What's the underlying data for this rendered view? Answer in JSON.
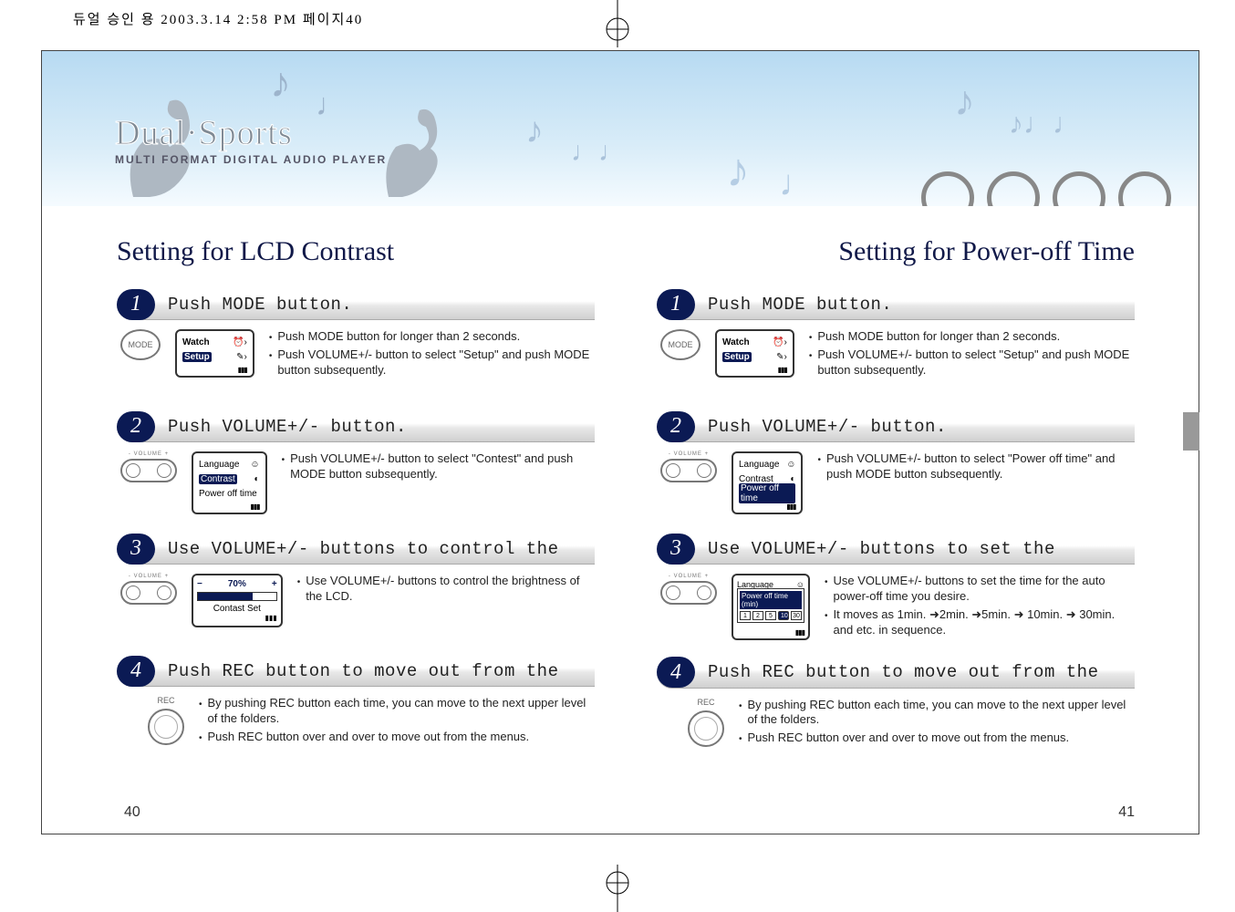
{
  "header_info": "듀얼 승인 용  2003.3.14 2:58 PM  페이지40",
  "brand": "Dual·Sports",
  "brand_sub": "MULTI FORMAT DIGITAL AUDIO PLAYER",
  "left": {
    "title": "Setting for LCD Contrast",
    "steps": [
      {
        "num": "1",
        "title": "Push MODE button.",
        "device": "mode",
        "lcd": {
          "rows": [
            "Watch",
            "Setup"
          ],
          "selected": 1,
          "icons": [
            "⏰›",
            "✎›"
          ]
        },
        "bullets": [
          "Push MODE button for longer than 2 seconds.",
          "Push VOLUME+/- button to select \"Setup\" and push MODE button subsequently."
        ]
      },
      {
        "num": "2",
        "title": "Push VOLUME+/- button.",
        "device": "volume",
        "lcd": {
          "rows": [
            "Language",
            "Contrast",
            "Power off time"
          ],
          "selected": 1,
          "icons": [
            "☺",
            "◐",
            ""
          ]
        },
        "bullets": [
          "Push VOLUME+/- button to select \"Contest\" and push MODE button subsequently."
        ]
      },
      {
        "num": "3",
        "title": "Use VOLUME+/- buttons to control the",
        "device": "volume",
        "lcd_bar": {
          "pct": "70%",
          "label": "Contast Set"
        },
        "bullets": [
          "Use VOLUME+/- buttons to control the brightness of the LCD."
        ]
      },
      {
        "num": "4",
        "title": "Push REC button to move out from the",
        "device": "rec",
        "bullets": [
          "By pushing REC button each time, you can move to the next upper level of the folders.",
          "Push REC button over and over to move out from the menus."
        ]
      }
    ],
    "page": "40"
  },
  "right": {
    "title": "Setting for Power-off Time",
    "steps": [
      {
        "num": "1",
        "title": "Push MODE button.",
        "device": "mode",
        "lcd": {
          "rows": [
            "Watch",
            "Setup"
          ],
          "selected": 1,
          "icons": [
            "⏰›",
            "✎›"
          ]
        },
        "bullets": [
          "Push MODE button for longer than 2 seconds.",
          "Push VOLUME+/- button to select \"Setup\" and push MODE button subsequently."
        ]
      },
      {
        "num": "2",
        "title": "Push VOLUME+/- button.",
        "device": "volume",
        "lcd": {
          "rows": [
            "Language",
            "Contrast",
            "Power off time"
          ],
          "selected": 2,
          "icons": [
            "☺",
            "◐",
            ""
          ]
        },
        "bullets": [
          "Push VOLUME+/- button to select \"Power off time\" and push MODE button subsequently."
        ]
      },
      {
        "num": "3",
        "title": "Use VOLUME+/- buttons to set the",
        "device": "volume",
        "popup": {
          "title": "Power off time (min)",
          "hidden_row": "Language",
          "values": [
            "1",
            "2",
            "5",
            "10",
            "30"
          ],
          "selected": 3
        },
        "bullets": [
          "Use VOLUME+/- buttons to set the time for the auto power-off time you desire.",
          "It moves as 1min. ➜2min. ➜5min. ➜ 10min. ➜ 30min. and etc. in sequence."
        ]
      },
      {
        "num": "4",
        "title": "Push REC button to move out from the",
        "device": "rec",
        "bullets": [
          "By pushing REC button each time, you can move to the next upper level of the folders.",
          "Push REC button over and over to move out from the menus."
        ]
      }
    ],
    "page": "41"
  },
  "labels": {
    "mode": "MODE",
    "volume": "- VOLUME +",
    "rec": "REC"
  }
}
